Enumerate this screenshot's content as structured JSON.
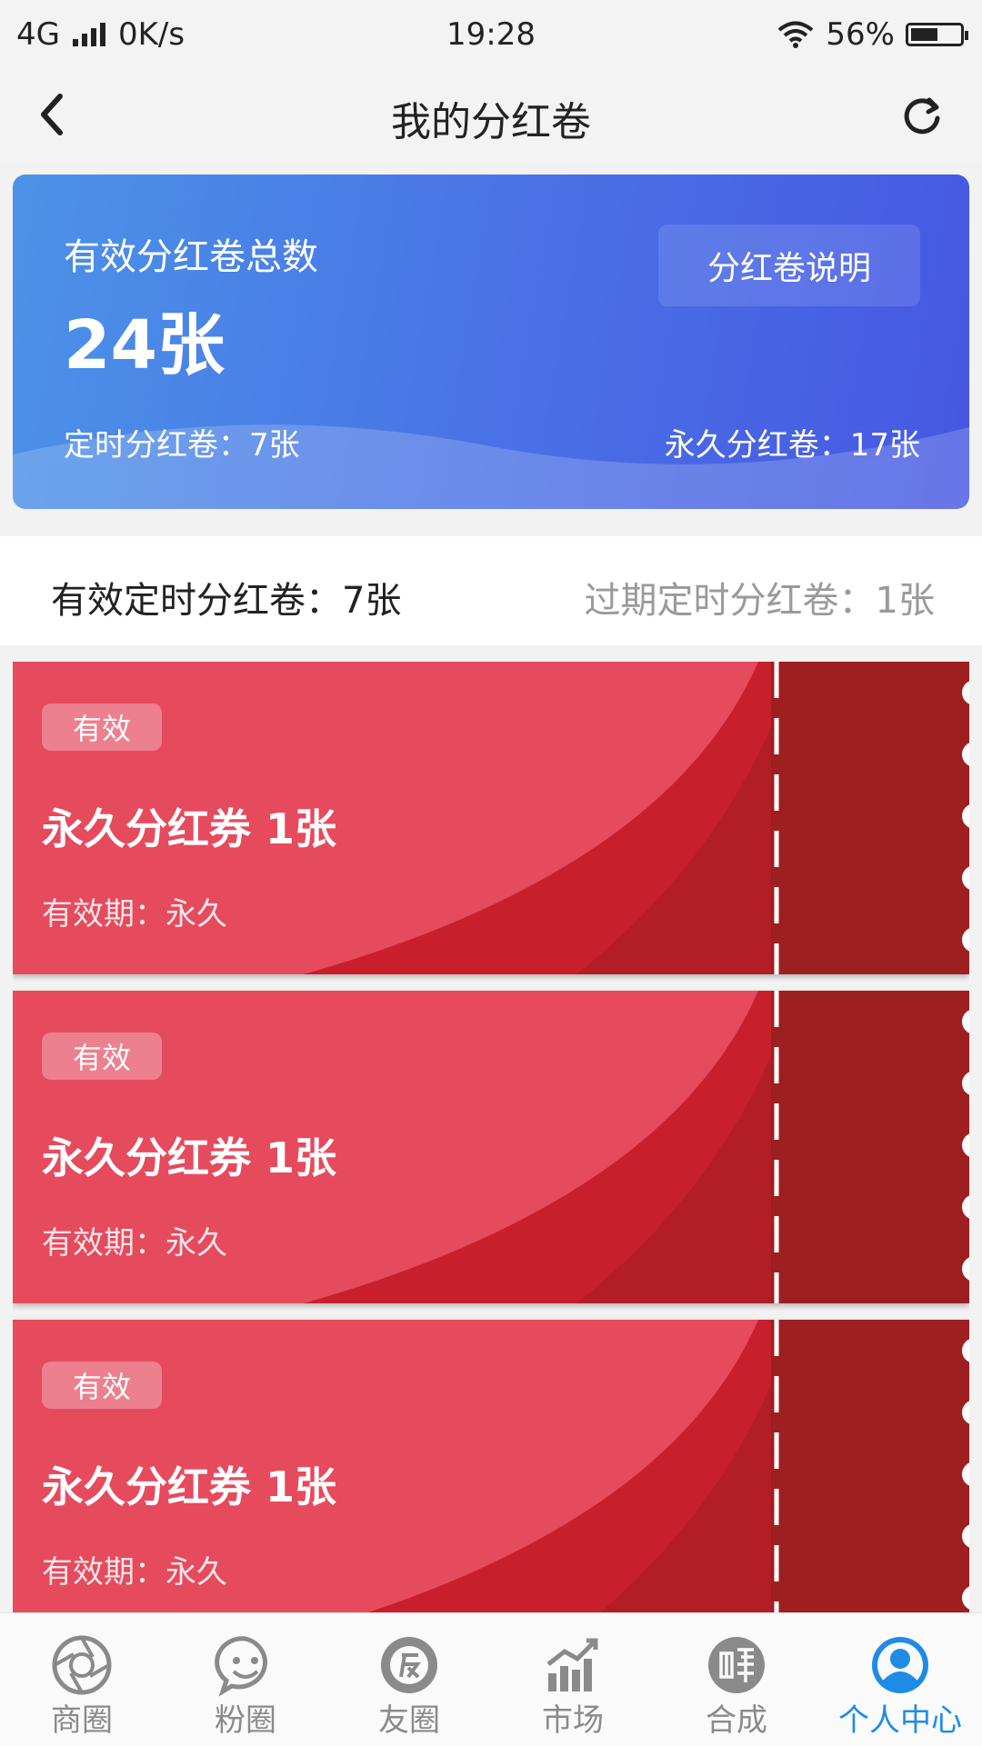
{
  "status_bar": {
    "network": "4G",
    "speed": "0K/s",
    "time": "19:28",
    "battery": "56%",
    "battery_level": 0.56
  },
  "header": {
    "title": "我的分红卷"
  },
  "summary": {
    "label": "有效分红卷总数",
    "total": "24张",
    "explain_button": "分红卷说明",
    "timed": "定时分红卷：7张",
    "permanent": "永久分红卷：17张"
  },
  "stats": {
    "valid_timed": "有效定时分红卷：7张",
    "expired_timed": "过期定时分红卷：1张"
  },
  "coupons": [
    {
      "badge": "有效",
      "title": "永久分红券 1张",
      "validity": "有效期：永久"
    },
    {
      "badge": "有效",
      "title": "永久分红券 1张",
      "validity": "有效期：永久"
    },
    {
      "badge": "有效",
      "title": "永久分红券 1张",
      "validity": "有效期：永久"
    }
  ],
  "nav": [
    {
      "label": "商圈",
      "icon": "aperture-icon"
    },
    {
      "label": "粉圈",
      "icon": "smile-chat-icon"
    },
    {
      "label": "友圈",
      "icon": "friend-circle-icon"
    },
    {
      "label": "市场",
      "icon": "market-chart-icon"
    },
    {
      "label": "合成",
      "icon": "earn-icon"
    },
    {
      "label": "个人中心",
      "icon": "person-icon",
      "active": true
    }
  ],
  "colors": {
    "accent": "#1e8ce6",
    "coupon_red": "#e44a5c",
    "summary_blue": "#4a76e6"
  }
}
